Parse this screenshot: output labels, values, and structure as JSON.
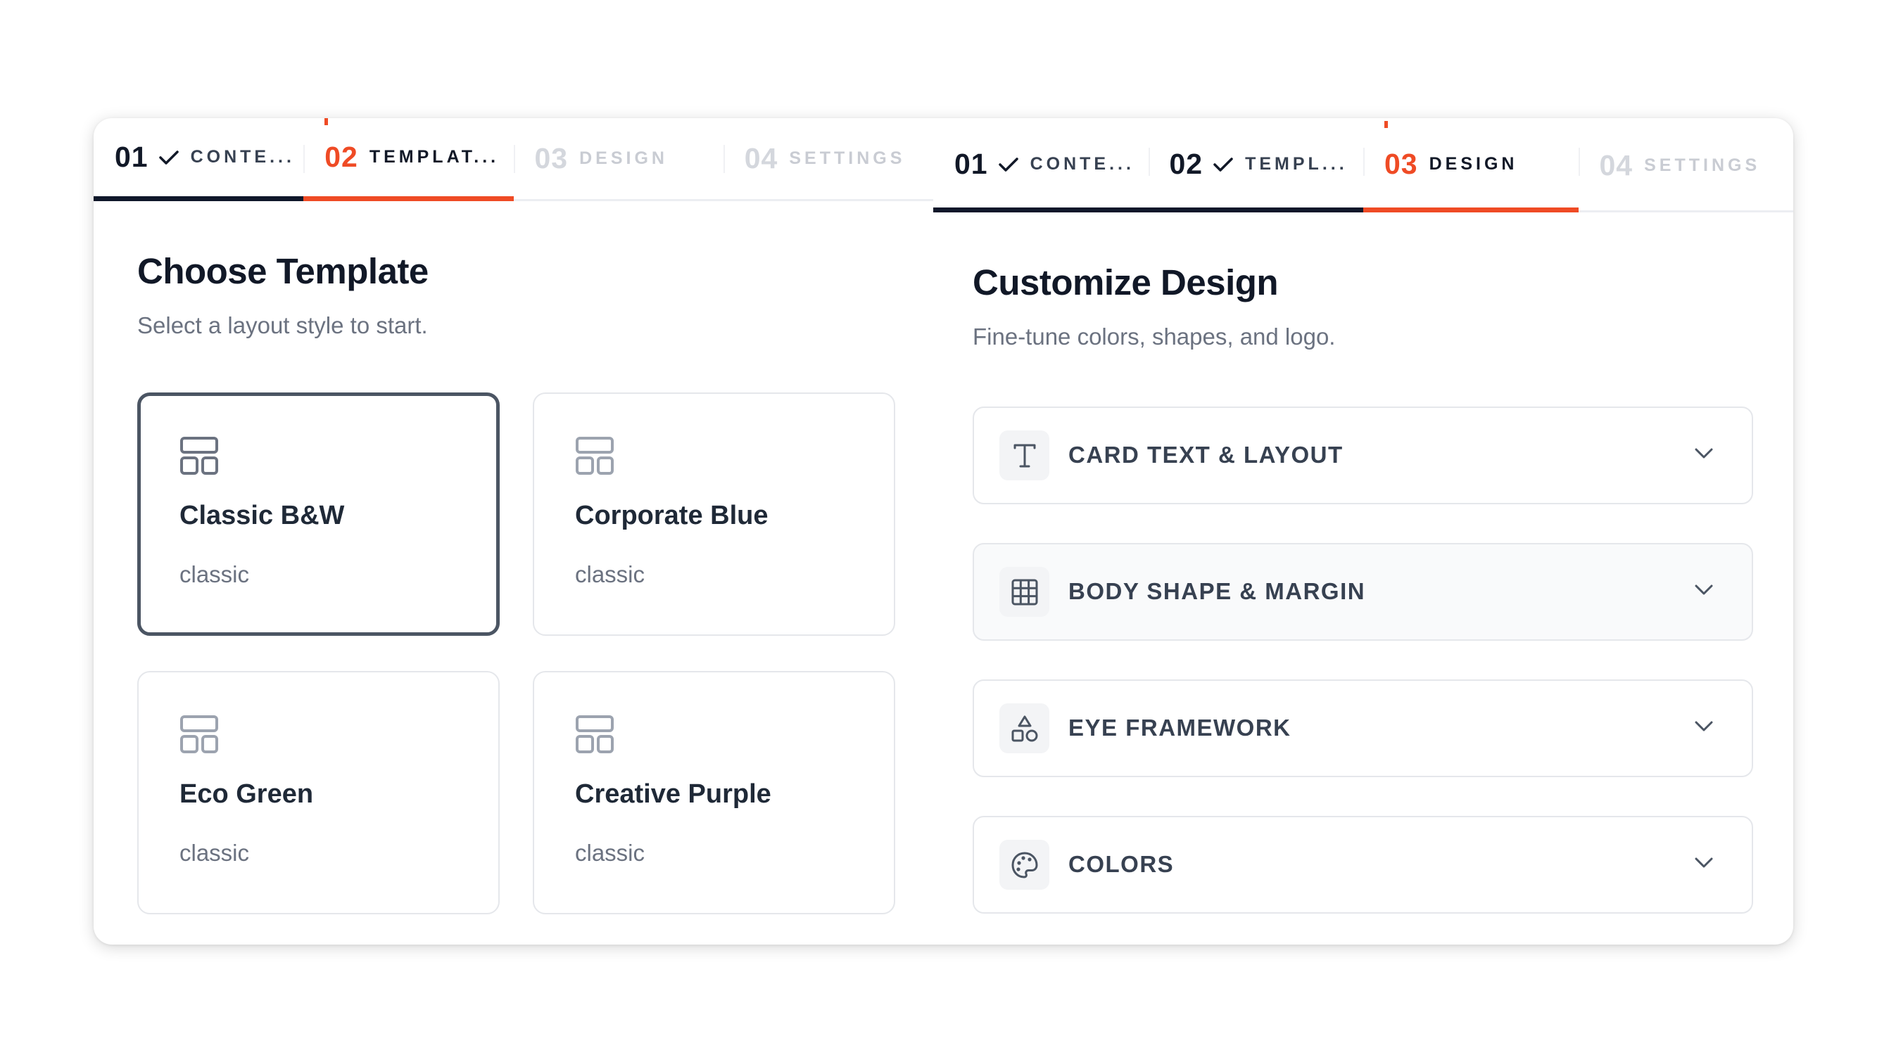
{
  "left_panel": {
    "steps": [
      {
        "num": "01",
        "label": "CONTE...",
        "state": "done"
      },
      {
        "num": "02",
        "label": "TEMPLAT...",
        "state": "active"
      },
      {
        "num": "03",
        "label": "DESIGN",
        "state": "todo"
      },
      {
        "num": "04",
        "label": "SETTINGS",
        "state": "todo"
      }
    ],
    "title": "Choose Template",
    "subtitle": "Select a layout style to start.",
    "templates": [
      {
        "name": "Classic B&W",
        "style": "classic",
        "selected": true,
        "icon": "layout-template-icon"
      },
      {
        "name": "Corporate Blue",
        "style": "classic",
        "selected": false,
        "icon": "layout-template-icon"
      },
      {
        "name": "Eco Green",
        "style": "classic",
        "selected": false,
        "icon": "layout-template-icon"
      },
      {
        "name": "Creative Purple",
        "style": "classic",
        "selected": false,
        "icon": "layout-template-icon"
      }
    ]
  },
  "right_panel": {
    "steps": [
      {
        "num": "01",
        "label": "CONTE...",
        "state": "done"
      },
      {
        "num": "02",
        "label": "TEMPL...",
        "state": "done"
      },
      {
        "num": "03",
        "label": "DESIGN",
        "state": "active"
      },
      {
        "num": "04",
        "label": "SETTINGS",
        "state": "todo"
      }
    ],
    "title": "Customize Design",
    "subtitle": "Fine-tune colors, shapes, and logo.",
    "sections": [
      {
        "label": "CARD TEXT & LAYOUT",
        "icon": "type-icon"
      },
      {
        "label": "BODY SHAPE & MARGIN",
        "icon": "grid-icon"
      },
      {
        "label": "EYE FRAMEWORK",
        "icon": "shapes-icon"
      },
      {
        "label": "COLORS",
        "icon": "palette-icon"
      }
    ]
  },
  "colors": {
    "accent": "#ef4b25",
    "done": "#0f172a",
    "muted": "#c9ccd3"
  }
}
